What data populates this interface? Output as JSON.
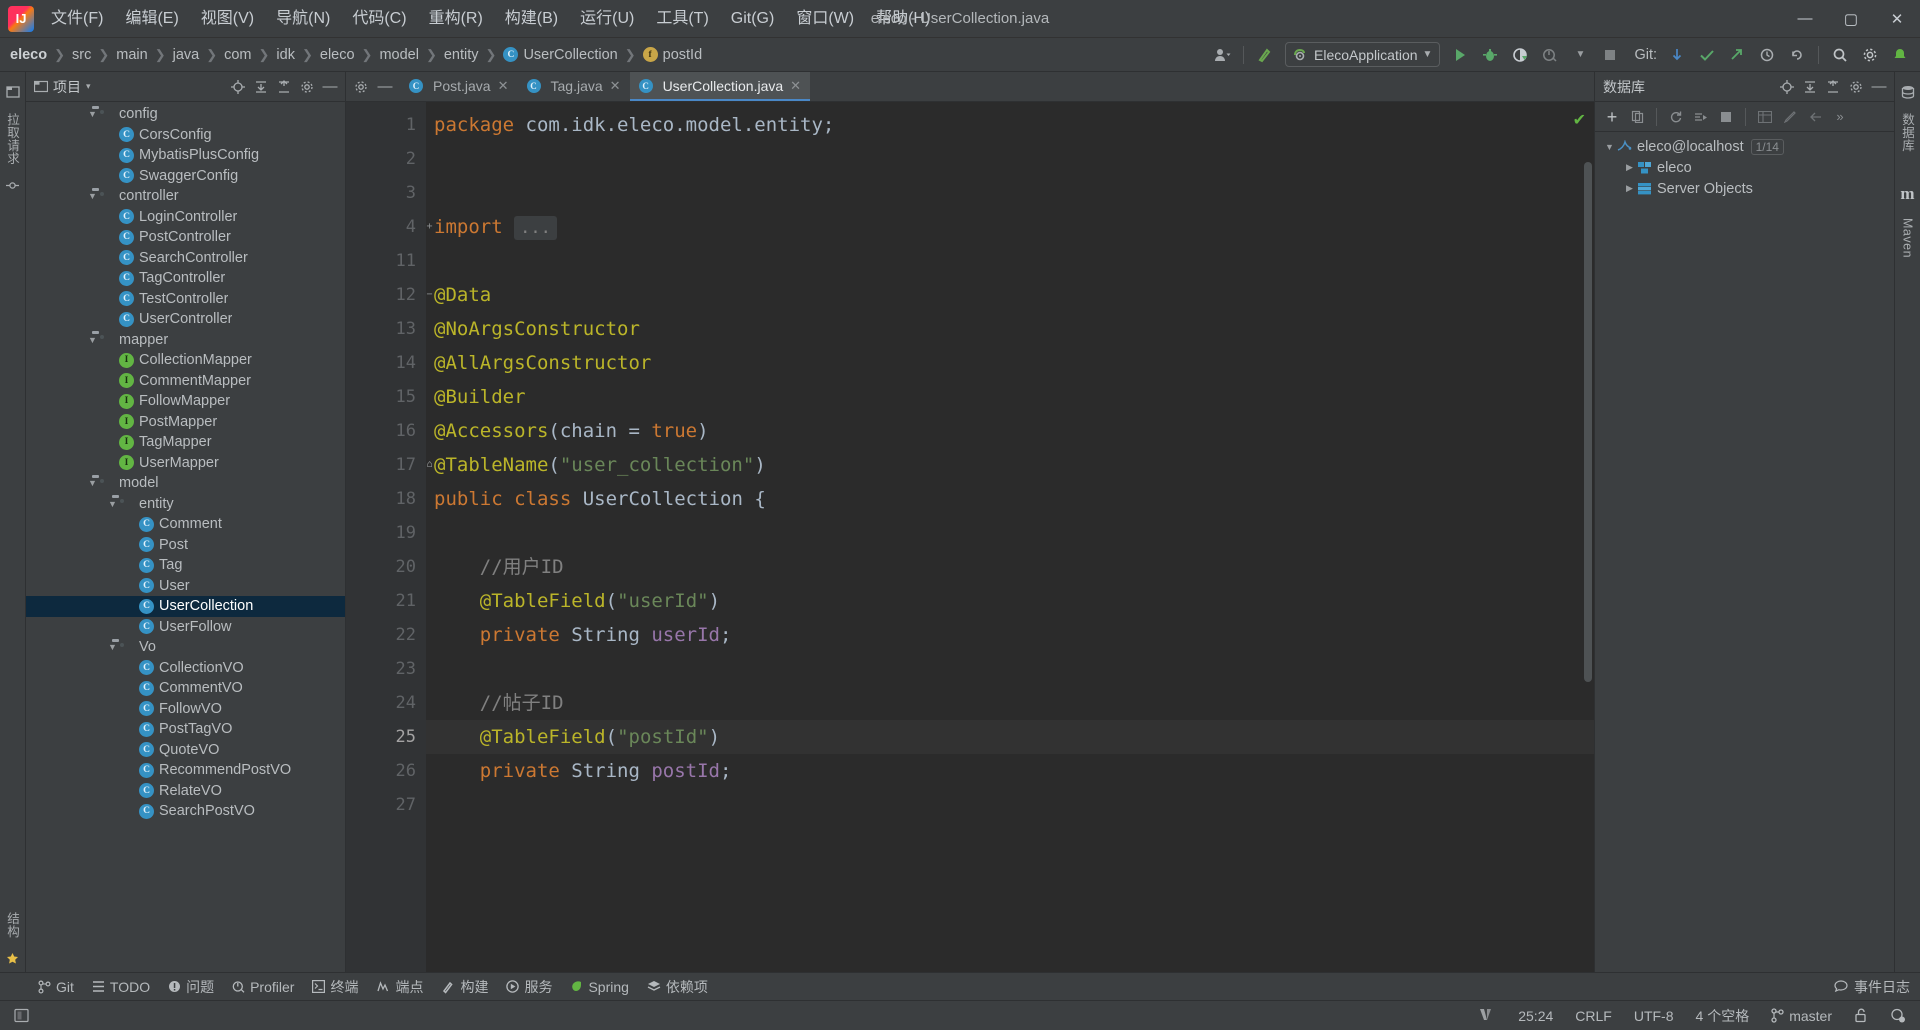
{
  "window": {
    "title": "eleco - UserCollection.java",
    "logo_text": "IJ",
    "minimize": "—",
    "maximize": "▢",
    "close": "✕"
  },
  "menubar": {
    "items": [
      {
        "label": "文件(F)",
        "name": "menu-file"
      },
      {
        "label": "编辑(E)",
        "name": "menu-edit"
      },
      {
        "label": "视图(V)",
        "name": "menu-view"
      },
      {
        "label": "导航(N)",
        "name": "menu-navigate"
      },
      {
        "label": "代码(C)",
        "name": "menu-code"
      },
      {
        "label": "重构(R)",
        "name": "menu-refactor"
      },
      {
        "label": "构建(B)",
        "name": "menu-build"
      },
      {
        "label": "运行(U)",
        "name": "menu-run"
      },
      {
        "label": "工具(T)",
        "name": "menu-tools"
      },
      {
        "label": "Git(G)",
        "name": "menu-git"
      },
      {
        "label": "窗口(W)",
        "name": "menu-window"
      },
      {
        "label": "帮助(H)",
        "name": "menu-help"
      }
    ]
  },
  "navbar": {
    "breadcrumbs": [
      {
        "label": "eleco",
        "icon": "",
        "bold": true
      },
      {
        "label": "src",
        "icon": ""
      },
      {
        "label": "main",
        "icon": ""
      },
      {
        "label": "java",
        "icon": ""
      },
      {
        "label": "com",
        "icon": ""
      },
      {
        "label": "idk",
        "icon": ""
      },
      {
        "label": "eleco",
        "icon": ""
      },
      {
        "label": "model",
        "icon": ""
      },
      {
        "label": "entity",
        "icon": ""
      },
      {
        "label": "UserCollection",
        "icon": "class-icon"
      },
      {
        "label": "postId",
        "icon": "field-icon"
      }
    ],
    "separator": "❯",
    "run_config": "ElecoApplication",
    "git_label": "Git:",
    "icons": {
      "account": "account-icon",
      "build": "build-icon",
      "run": "run-icon",
      "debug": "debug-icon",
      "run_coverage": "run-with-coverage-icon",
      "profiler": "profiler-icon",
      "stop": "stop-icon",
      "update": "update-project-icon",
      "commit": "commit-icon",
      "push": "push-icon",
      "history": "history-icon",
      "rollback": "rollback-icon",
      "search": "search-everywhere-icon",
      "settings": "settings-icon",
      "notification": "notifications-icon"
    }
  },
  "left_strip": {
    "tabs": [
      {
        "label": "项目",
        "name": "left-strip-project"
      },
      {
        "label": "拉取请求",
        "name": "left-strip-pull-requests"
      },
      {
        "label": "提交",
        "name": "left-strip-commit"
      }
    ],
    "bottom_tabs": [
      {
        "label": "结构",
        "name": "left-strip-structure"
      },
      {
        "label": "收藏夹",
        "name": "left-strip-bookmarks"
      }
    ]
  },
  "right_strip": {
    "tabs": [
      {
        "label": "数据库",
        "name": "right-strip-database"
      },
      {
        "label": "Maven",
        "name": "right-strip-maven"
      }
    ]
  },
  "project_panel": {
    "title": "项目",
    "dropdown": "▾",
    "toolbar_icons": [
      "locate-icon",
      "expand-all-icon",
      "collapse-all-icon",
      "settings-icon",
      "hide-icon"
    ],
    "tree": [
      {
        "label": "config",
        "type": "folder",
        "indent": 3,
        "expanded": true
      },
      {
        "label": "CorsConfig",
        "type": "class",
        "indent": 4
      },
      {
        "label": "MybatisPlusConfig",
        "type": "class",
        "indent": 4
      },
      {
        "label": "SwaggerConfig",
        "type": "class",
        "indent": 4
      },
      {
        "label": "controller",
        "type": "folder",
        "indent": 3,
        "expanded": true
      },
      {
        "label": "LoginController",
        "type": "class",
        "indent": 4
      },
      {
        "label": "PostController",
        "type": "class",
        "indent": 4
      },
      {
        "label": "SearchController",
        "type": "class",
        "indent": 4
      },
      {
        "label": "TagController",
        "type": "class",
        "indent": 4
      },
      {
        "label": "TestController",
        "type": "class",
        "indent": 4
      },
      {
        "label": "UserController",
        "type": "class",
        "indent": 4
      },
      {
        "label": "mapper",
        "type": "folder",
        "indent": 3,
        "expanded": true
      },
      {
        "label": "CollectionMapper",
        "type": "interface",
        "indent": 4
      },
      {
        "label": "CommentMapper",
        "type": "interface",
        "indent": 4
      },
      {
        "label": "FollowMapper",
        "type": "interface",
        "indent": 4
      },
      {
        "label": "PostMapper",
        "type": "interface",
        "indent": 4
      },
      {
        "label": "TagMapper",
        "type": "interface",
        "indent": 4
      },
      {
        "label": "UserMapper",
        "type": "interface",
        "indent": 4
      },
      {
        "label": "model",
        "type": "folder",
        "indent": 3,
        "expanded": true
      },
      {
        "label": "entity",
        "type": "folder",
        "indent": 4,
        "expanded": true
      },
      {
        "label": "Comment",
        "type": "class",
        "indent": 5
      },
      {
        "label": "Post",
        "type": "class",
        "indent": 5
      },
      {
        "label": "Tag",
        "type": "class",
        "indent": 5
      },
      {
        "label": "User",
        "type": "class",
        "indent": 5
      },
      {
        "label": "UserCollection",
        "type": "class",
        "indent": 5,
        "selected": true
      },
      {
        "label": "UserFollow",
        "type": "class",
        "indent": 5
      },
      {
        "label": "Vo",
        "type": "folder",
        "indent": 4,
        "expanded": true
      },
      {
        "label": "CollectionVO",
        "type": "class",
        "indent": 5
      },
      {
        "label": "CommentVO",
        "type": "class",
        "indent": 5
      },
      {
        "label": "FollowVO",
        "type": "class",
        "indent": 5
      },
      {
        "label": "PostTagVO",
        "type": "class",
        "indent": 5
      },
      {
        "label": "QuoteVO",
        "type": "class",
        "indent": 5
      },
      {
        "label": "RecommendPostVO",
        "type": "class",
        "indent": 5
      },
      {
        "label": "RelateVO",
        "type": "class",
        "indent": 5
      },
      {
        "label": "SearchPostVO",
        "type": "class",
        "indent": 5
      }
    ]
  },
  "editor": {
    "tabs": [
      {
        "label": "Post.java",
        "active": false
      },
      {
        "label": "Tag.java",
        "active": false
      },
      {
        "label": "UserCollection.java",
        "active": true
      }
    ],
    "close_glyph": "✕",
    "inspection_status": "✔",
    "lines": [
      {
        "no": "1",
        "fold": "",
        "html": "<span class=\"k\">package</span> com.idk.eleco.model.entity;"
      },
      {
        "no": "2",
        "fold": "",
        "html": ""
      },
      {
        "no": "3",
        "fold": "",
        "html": ""
      },
      {
        "no": "4",
        "fold": "+",
        "html": "<span class=\"k\">import</span> <span class=\"ellipsis-box\">...</span>"
      },
      {
        "no": "11",
        "fold": "",
        "html": ""
      },
      {
        "no": "12",
        "fold": "−",
        "html": "<span class=\"ann\">@Data</span>"
      },
      {
        "no": "13",
        "fold": "",
        "html": "<span class=\"ann\">@NoArgsConstructor</span>"
      },
      {
        "no": "14",
        "fold": "",
        "html": "<span class=\"ann\">@AllArgsConstructor</span>"
      },
      {
        "no": "15",
        "fold": "",
        "html": "<span class=\"ann\">@Builder</span>"
      },
      {
        "no": "16",
        "fold": "",
        "html": "<span class=\"ann\">@Accessors</span>(chain = <span class=\"k\">true</span>)"
      },
      {
        "no": "17",
        "fold": "⌂",
        "html": "<span class=\"ann\">@TableName</span>(<span class=\"str\">\"user_collection\"</span>)"
      },
      {
        "no": "18",
        "fold": "",
        "html": "<span class=\"k\">public</span> <span class=\"k\">class</span> UserCollection {"
      },
      {
        "no": "19",
        "fold": "",
        "html": ""
      },
      {
        "no": "20",
        "fold": "",
        "html": "    <span class=\"cmt\">//用户ID</span>"
      },
      {
        "no": "21",
        "fold": "",
        "html": "    <span class=\"ann\">@TableField</span>(<span class=\"str\">\"userId\"</span>)"
      },
      {
        "no": "22",
        "fold": "",
        "html": "    <span class=\"k\">private</span> String <span class=\"fld\">userId</span>;"
      },
      {
        "no": "23",
        "fold": "",
        "html": ""
      },
      {
        "no": "24",
        "fold": "",
        "html": "    <span class=\"cmt\">//帖子ID</span>"
      },
      {
        "no": "25",
        "fold": "",
        "html": "    <span class=\"ann\">@TableField</span>(<span class=\"str\">\"postId\"</span>)",
        "current": true,
        "bulb": true
      },
      {
        "no": "26",
        "fold": "",
        "html": "    <span class=\"k\">private</span> String <span class=\"fld\">postId</span>;"
      },
      {
        "no": "27",
        "fold": "",
        "html": ""
      }
    ]
  },
  "database_panel": {
    "title": "数据库",
    "head_icons": [
      "locate-icon",
      "expand-all-icon",
      "collapse-all-icon",
      "settings-icon",
      "hide-icon"
    ],
    "toolbar_icons": [
      "add-icon",
      "copy-icon",
      "refresh-icon",
      "run-sql-icon",
      "stop-icon",
      "table-icon",
      "edit-icon",
      "jump-icon",
      "more-icon"
    ],
    "tree": [
      {
        "label": "eleco@localhost",
        "badge": "1/14",
        "indent": 0,
        "expanded": true,
        "icon": "mysql-icon"
      },
      {
        "label": "eleco",
        "indent": 1,
        "expanded": false,
        "icon": "schema-icon"
      },
      {
        "label": "Server Objects",
        "indent": 1,
        "expanded": false,
        "icon": "server-objects-icon"
      }
    ]
  },
  "tool_windows": {
    "items": [
      {
        "label": "Git",
        "icon": "git-icon"
      },
      {
        "label": "TODO",
        "icon": "todo-icon"
      },
      {
        "label": "问题",
        "icon": "problems-icon"
      },
      {
        "label": "Profiler",
        "icon": "profiler-icon"
      },
      {
        "label": "终端",
        "icon": "terminal-icon"
      },
      {
        "label": "端点",
        "icon": "endpoints-icon"
      },
      {
        "label": "构建",
        "icon": "build-icon"
      },
      {
        "label": "服务",
        "icon": "services-icon"
      },
      {
        "label": "Spring",
        "icon": "spring-icon"
      },
      {
        "label": "依赖项",
        "icon": "dependencies-icon"
      }
    ],
    "event_log": "事件日志"
  },
  "statusbar": {
    "left_icon": "console-icon",
    "caret_position": "25:24",
    "line_separator": "CRLF",
    "encoding": "UTF-8",
    "indent": "4 个空格",
    "branch": "master",
    "lock_icon": "unlock-icon",
    "inspection_icon": "inspection-profile-icon"
  },
  "colors": {
    "accent_blue": "#4a88c7",
    "selection_blue": "#0d293e",
    "chrome_bg": "#3c3f41",
    "editor_bg": "#2b2b2b",
    "gutter_bg": "#313335",
    "green": "#62b543",
    "class_icon": "#3592c4",
    "annotation": "#bbb529",
    "keyword": "#cc7832",
    "string": "#6a8759",
    "field": "#9876aa",
    "comment": "#808080"
  }
}
